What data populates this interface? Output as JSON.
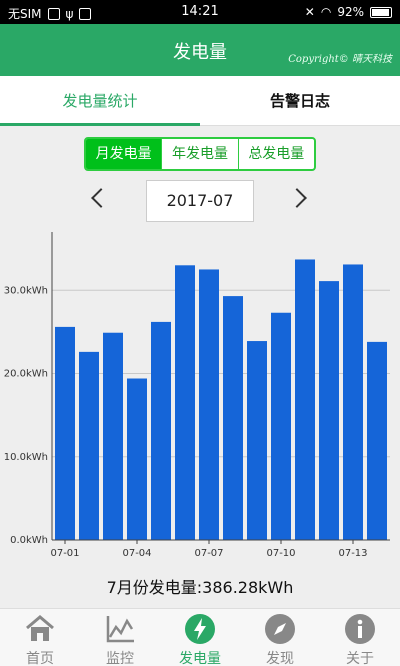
{
  "statusbar": {
    "carrier": "无SIM",
    "time": "14:21",
    "battery": "92%"
  },
  "appbar": {
    "title": "发电量",
    "copyright": "Copyright© 晴天科技"
  },
  "tabs": [
    {
      "label": "发电量统计"
    },
    {
      "label": "告警日志"
    }
  ],
  "segment": {
    "options": [
      "月发电量",
      "年发电量",
      "总发电量"
    ],
    "selected": "月发电量"
  },
  "date_picker": {
    "value": "2017-07"
  },
  "summary": {
    "text": "7月份发电量:386.28kWh"
  },
  "bottom_nav": [
    {
      "label": "首页"
    },
    {
      "label": "监控"
    },
    {
      "label": "发电量"
    },
    {
      "label": "发现"
    },
    {
      "label": "关于"
    }
  ],
  "colors": {
    "brand": "#2aa866",
    "bar": "#1565d8",
    "segment_active": "#00c01a"
  },
  "chart_data": {
    "type": "bar",
    "categories": [
      "07-01",
      "07-02",
      "07-03",
      "07-04",
      "07-05",
      "07-06",
      "07-07",
      "07-08",
      "07-09",
      "07-10",
      "07-11",
      "07-12",
      "07-13",
      "07-14"
    ],
    "x_tick_labels": [
      "07-01",
      "07-04",
      "07-07",
      "07-10",
      "07-13"
    ],
    "values": [
      25.6,
      22.6,
      24.9,
      19.4,
      26.2,
      33.0,
      32.5,
      29.3,
      23.9,
      27.3,
      33.7,
      31.1,
      33.1,
      23.8
    ],
    "y_ticks": [
      "0.0kWh",
      "10.0kWh",
      "20.0kWh",
      "30.0kWh"
    ],
    "ylim": [
      0,
      37
    ],
    "grid": "horizontal"
  }
}
